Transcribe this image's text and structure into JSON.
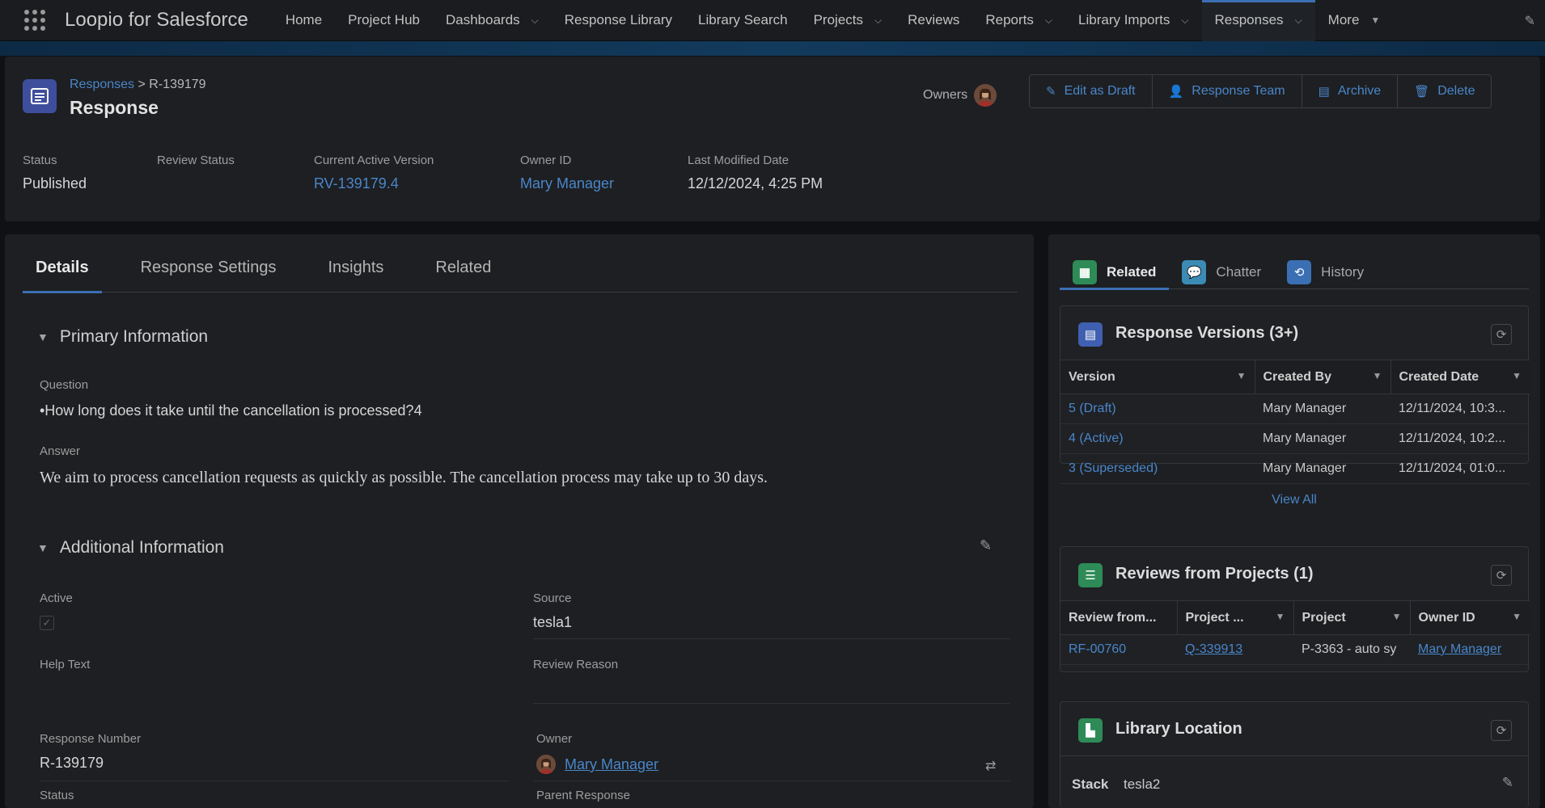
{
  "nav": {
    "app_name": "Loopio for Salesforce",
    "items": [
      {
        "label": "Home",
        "has_menu": false
      },
      {
        "label": "Project Hub",
        "has_menu": false
      },
      {
        "label": "Dashboards",
        "has_menu": true
      },
      {
        "label": "Response Library",
        "has_menu": false
      },
      {
        "label": "Library Search",
        "has_menu": false
      },
      {
        "label": "Projects",
        "has_menu": true
      },
      {
        "label": "Reviews",
        "has_menu": false
      },
      {
        "label": "Reports",
        "has_menu": true
      },
      {
        "label": "Library Imports",
        "has_menu": true
      },
      {
        "label": "Responses",
        "has_menu": true,
        "active": true
      },
      {
        "label": "More",
        "has_menu": true
      }
    ]
  },
  "header": {
    "breadcrumb_link": "Responses",
    "breadcrumb_sep": ">",
    "breadcrumb_current": "R-139179",
    "title": "Response",
    "owners_label": "Owners",
    "buttons": {
      "edit_draft": "Edit as Draft",
      "response_team": "Response Team",
      "archive": "Archive",
      "delete": "Delete"
    },
    "fields": {
      "status_label": "Status",
      "status_value": "Published",
      "review_status_label": "Review Status",
      "review_status_value": "",
      "current_version_label": "Current Active Version",
      "current_version_value": "RV-139179.4",
      "owner_id_label": "Owner ID",
      "owner_id_value": "Mary Manager",
      "last_modified_label": "Last Modified Date",
      "last_modified_value": "12/12/2024, 4:25 PM"
    }
  },
  "tabs": [
    "Details",
    "Response Settings",
    "Insights",
    "Related"
  ],
  "details": {
    "primary_title": "Primary Information",
    "question_label": "Question",
    "question_value": "•How long does it take until the cancellation is processed?4",
    "answer_label": "Answer",
    "answer_value": "We aim to process cancellation requests as quickly as possible. The cancellation process may take up to 30 days.",
    "additional_title": "Additional Information",
    "active_label": "Active",
    "active_check": "✓",
    "source_label": "Source",
    "source_value": "tesla1",
    "help_text_label": "Help Text",
    "review_reason_label": "Review Reason",
    "response_number_label": "Response Number",
    "response_number_value": "R-139179",
    "owner_label": "Owner",
    "owner_value": "Mary Manager",
    "status_label": "Status",
    "parent_response_label": "Parent Response"
  },
  "right": {
    "tabs": [
      "Related",
      "Chatter",
      "History"
    ],
    "versions": {
      "title": "Response Versions (3+)",
      "columns": [
        "Version",
        "Created By",
        "Created Date"
      ],
      "rows": [
        [
          "5 (Draft)",
          "Mary Manager",
          "12/11/2024, 10:3..."
        ],
        [
          "4 (Active)",
          "Mary Manager",
          "12/11/2024, 10:2..."
        ],
        [
          "3 (Superseded)",
          "Mary Manager",
          "12/11/2024, 01:0..."
        ]
      ],
      "view_all": "View All"
    },
    "reviews": {
      "title": "Reviews from Projects (1)",
      "columns": [
        "Review from...",
        "Project ...",
        "Project",
        "Owner ID"
      ],
      "rows": [
        [
          "RF-00760",
          "Q-339913",
          "P-3363 - auto sy",
          "Mary Manager"
        ]
      ]
    },
    "library": {
      "title": "Library Location",
      "stack_label": "Stack",
      "stack_value": "tesla2"
    }
  },
  "colors": {
    "link": "#4a86c9",
    "accent": "#3b6fb3",
    "record_icon": "#3f4e9c",
    "related_icon": "#2e8b57",
    "chatter_icon": "#3b8bb5",
    "history_icon": "#3b6fb3"
  }
}
